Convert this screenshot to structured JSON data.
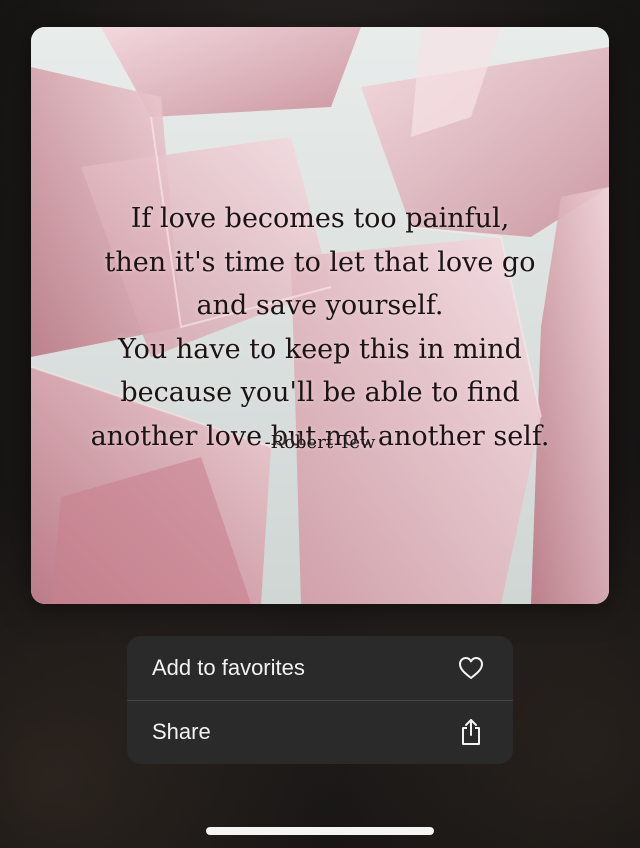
{
  "quote": {
    "lines": [
      "If love becomes too painful,",
      "then it's time to let that love go",
      "and save yourself.",
      "You have to keep this in mind",
      "because you'll be able to find",
      "another love but not another self."
    ],
    "author": "-Robert Tew"
  },
  "menu": {
    "items": [
      {
        "label": "Add to favorites",
        "icon": "heart-icon"
      },
      {
        "label": "Share",
        "icon": "share-icon"
      }
    ]
  },
  "colors": {
    "menu_background": "#2b2a2a",
    "crystal_pink": "#e7c3c8",
    "quote_text": "#1b1414"
  }
}
